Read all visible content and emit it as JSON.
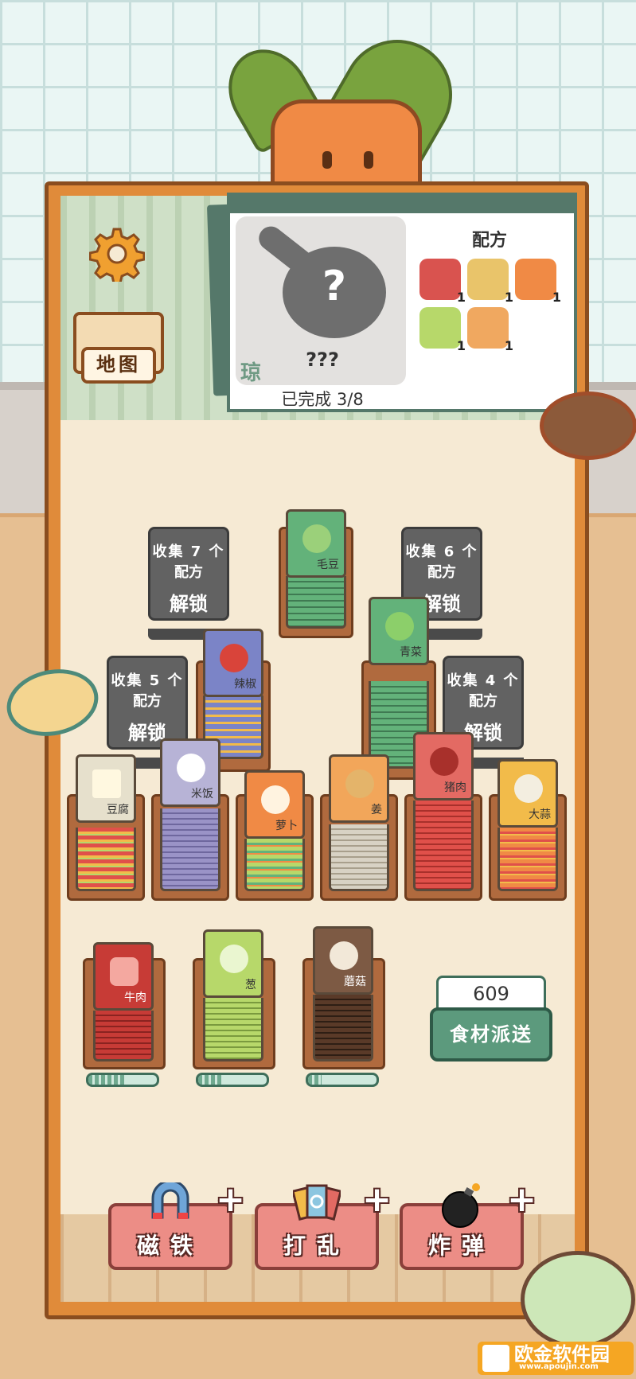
{
  "settings": {
    "icon": "gear-icon"
  },
  "map_button": {
    "label": "地图",
    "icon": "book-map-icon"
  },
  "recipe_panel": {
    "dish_name": "???",
    "dish_mark": "琼",
    "progress_label": "已完成 3/8",
    "recipe_title": "配方",
    "ingredients": [
      {
        "icon": "meat-icon",
        "count": "1",
        "color": "#d9534f"
      },
      {
        "icon": "potato-icon",
        "count": "1",
        "color": "#e9c46a"
      },
      {
        "icon": "radish-icon",
        "count": "1",
        "color": "#f08a45"
      },
      {
        "icon": "scallion-icon",
        "count": "1",
        "color": "#b7d86a"
      },
      {
        "icon": "ginger-icon",
        "count": "1",
        "color": "#f0a860"
      }
    ]
  },
  "locked_slots": [
    {
      "line1": "收集 7 个",
      "line2": "配方",
      "line3": "解锁"
    },
    {
      "line1": "收集 6 个",
      "line2": "配方",
      "line3": "解锁"
    },
    {
      "line1": "收集 5 个",
      "line2": "配方",
      "line3": "解锁"
    },
    {
      "line1": "收集 4 个",
      "line2": "配方",
      "line3": "解锁"
    }
  ],
  "tiles": {
    "edamame": {
      "label": "毛豆",
      "color": "#63b27a"
    },
    "chili": {
      "label": "辣椒",
      "color": "#7b84c7"
    },
    "greens": {
      "label": "青菜",
      "color": "#63b27a"
    },
    "tofu": {
      "label": "豆腐",
      "color": "#e6e0cc"
    },
    "rice": {
      "label": "米饭",
      "color": "#b7b3d6"
    },
    "radish": {
      "label": "萝卜",
      "color": "#f08a45"
    },
    "ginger": {
      "label": "姜",
      "color": "#f2a65a"
    },
    "pork": {
      "label": "猪肉",
      "color": "#e36a63"
    },
    "garlic": {
      "label": "大蒜",
      "color": "#f2bb4a"
    },
    "beef": {
      "label": "牛肉",
      "color": "#c73b36"
    },
    "scallion": {
      "label": "葱",
      "color": "#b7d86a"
    },
    "mushroom": {
      "label": "蘑菇",
      "color": "#7d5a44"
    }
  },
  "delivery": {
    "count": "609",
    "button_label": "食材派送"
  },
  "tools": [
    {
      "label": "磁铁",
      "icon": "magnet-icon",
      "plus": "+"
    },
    {
      "label": "打乱",
      "icon": "shuffle-icon",
      "plus": "+"
    },
    {
      "label": "炸弹",
      "icon": "bomb-icon",
      "plus": "+"
    }
  ],
  "queue_progress": [
    0.55,
    0.35,
    0.2
  ],
  "watermark": {
    "brand": "欧金软件园",
    "url": "www.apoujin.com"
  }
}
